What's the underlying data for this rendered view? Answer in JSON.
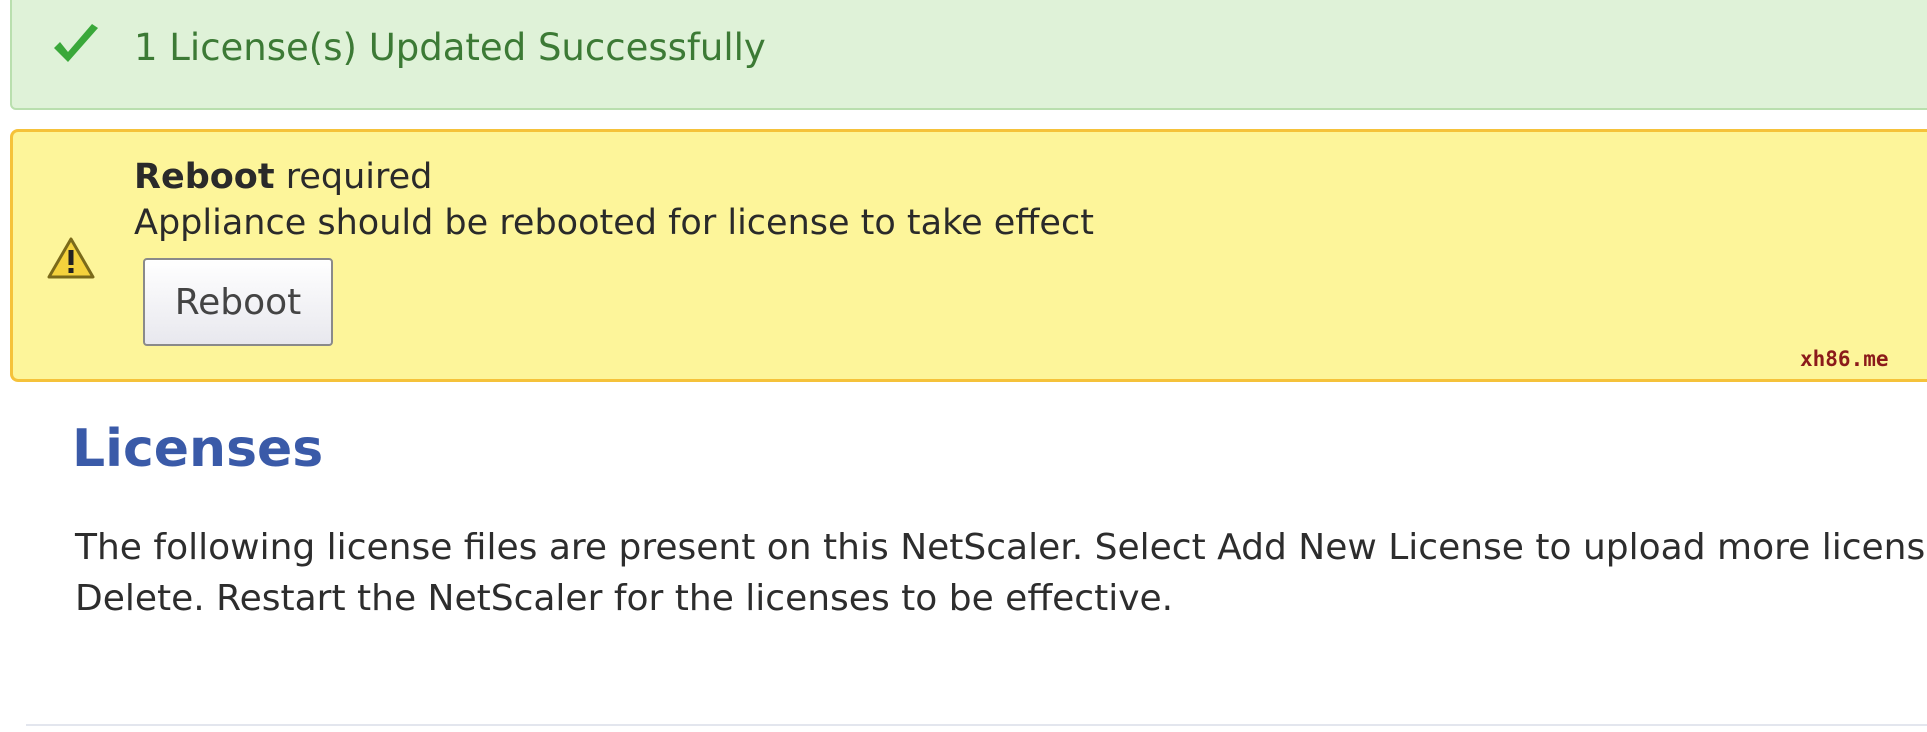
{
  "success": {
    "message": "1 License(s) Updated Successfully",
    "icon": "checkmark-icon",
    "color": "#3c7a35"
  },
  "warning": {
    "title_bold": "Reboot",
    "title_rest": " required",
    "message": "Appliance should be rebooted for license to take effect",
    "icon": "warning-triangle-icon",
    "button_label": "Reboot"
  },
  "watermark": "xh86.me",
  "licenses": {
    "title": "Licenses",
    "description_line1": "The following license files are present on this NetScaler. Select Add New License to upload more licenses.",
    "description_line2": "Delete. Restart the NetScaler for the licenses to be effective."
  },
  "colors": {
    "success_bg": "#dff2d8",
    "warning_bg": "#fdf59a",
    "warning_border": "#f5c23a",
    "title_blue": "#3a5aa8"
  }
}
